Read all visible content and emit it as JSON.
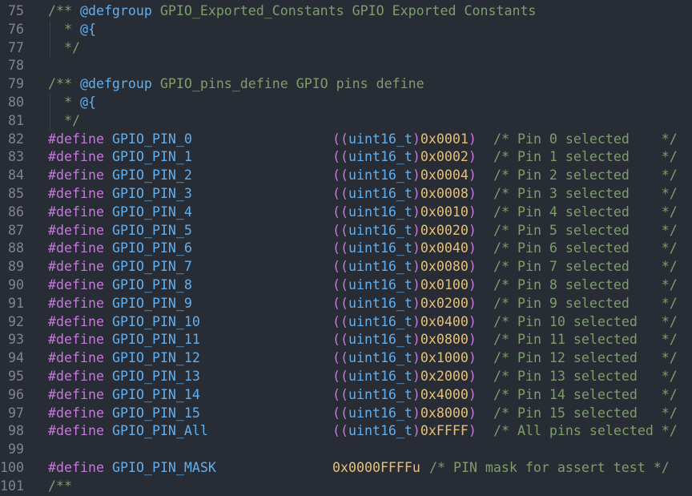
{
  "editor": {
    "colors": {
      "background": "#282c34",
      "comment": "#7f9d6b",
      "keyword": "#c678dd",
      "identifier": "#61afef",
      "literal": "#e5c07b",
      "line_number": "#7f848e"
    },
    "blocks": [
      {
        "line": "75",
        "prefix": "/** ",
        "tag": "@defgroup",
        "text": " GPIO_Exported_Constants GPIO Exported Constants"
      },
      {
        "line": "76",
        "prefix": "  * ",
        "tag": "@{",
        "text": ""
      },
      {
        "line": "77",
        "prefix": "  */",
        "tag": "",
        "text": ""
      },
      {
        "line": "78",
        "prefix": "",
        "tag": "",
        "text": ""
      },
      {
        "line": "79",
        "prefix": "/** ",
        "tag": "@defgroup",
        "text": " GPIO_pins_define GPIO pins define"
      },
      {
        "line": "80",
        "prefix": "  * ",
        "tag": "@{",
        "text": ""
      },
      {
        "line": "81",
        "prefix": "  */",
        "tag": "",
        "text": ""
      }
    ],
    "defines": [
      {
        "line": "82",
        "kw": "#define",
        "name": "GPIO_PIN_0",
        "cast_open": "((",
        "type": "uint16_t",
        "cast_close": ")",
        "value": "0x0001",
        "paren": ")",
        "comment": "/* Pin 0 selected    */"
      },
      {
        "line": "83",
        "kw": "#define",
        "name": "GPIO_PIN_1",
        "cast_open": "((",
        "type": "uint16_t",
        "cast_close": ")",
        "value": "0x0002",
        "paren": ")",
        "comment": "/* Pin 1 selected    */"
      },
      {
        "line": "84",
        "kw": "#define",
        "name": "GPIO_PIN_2",
        "cast_open": "((",
        "type": "uint16_t",
        "cast_close": ")",
        "value": "0x0004",
        "paren": ")",
        "comment": "/* Pin 2 selected    */"
      },
      {
        "line": "85",
        "kw": "#define",
        "name": "GPIO_PIN_3",
        "cast_open": "((",
        "type": "uint16_t",
        "cast_close": ")",
        "value": "0x0008",
        "paren": ")",
        "comment": "/* Pin 3 selected    */"
      },
      {
        "line": "86",
        "kw": "#define",
        "name": "GPIO_PIN_4",
        "cast_open": "((",
        "type": "uint16_t",
        "cast_close": ")",
        "value": "0x0010",
        "paren": ")",
        "comment": "/* Pin 4 selected    */"
      },
      {
        "line": "87",
        "kw": "#define",
        "name": "GPIO_PIN_5",
        "cast_open": "((",
        "type": "uint16_t",
        "cast_close": ")",
        "value": "0x0020",
        "paren": ")",
        "comment": "/* Pin 5 selected    */"
      },
      {
        "line": "88",
        "kw": "#define",
        "name": "GPIO_PIN_6",
        "cast_open": "((",
        "type": "uint16_t",
        "cast_close": ")",
        "value": "0x0040",
        "paren": ")",
        "comment": "/* Pin 6 selected    */"
      },
      {
        "line": "89",
        "kw": "#define",
        "name": "GPIO_PIN_7",
        "cast_open": "((",
        "type": "uint16_t",
        "cast_close": ")",
        "value": "0x0080",
        "paren": ")",
        "comment": "/* Pin 7 selected    */"
      },
      {
        "line": "90",
        "kw": "#define",
        "name": "GPIO_PIN_8",
        "cast_open": "((",
        "type": "uint16_t",
        "cast_close": ")",
        "value": "0x0100",
        "paren": ")",
        "comment": "/* Pin 8 selected    */"
      },
      {
        "line": "91",
        "kw": "#define",
        "name": "GPIO_PIN_9",
        "cast_open": "((",
        "type": "uint16_t",
        "cast_close": ")",
        "value": "0x0200",
        "paren": ")",
        "comment": "/* Pin 9 selected    */"
      },
      {
        "line": "92",
        "kw": "#define",
        "name": "GPIO_PIN_10",
        "cast_open": "((",
        "type": "uint16_t",
        "cast_close": ")",
        "value": "0x0400",
        "paren": ")",
        "comment": "/* Pin 10 selected   */"
      },
      {
        "line": "93",
        "kw": "#define",
        "name": "GPIO_PIN_11",
        "cast_open": "((",
        "type": "uint16_t",
        "cast_close": ")",
        "value": "0x0800",
        "paren": ")",
        "comment": "/* Pin 11 selected   */"
      },
      {
        "line": "94",
        "kw": "#define",
        "name": "GPIO_PIN_12",
        "cast_open": "((",
        "type": "uint16_t",
        "cast_close": ")",
        "value": "0x1000",
        "paren": ")",
        "comment": "/* Pin 12 selected   */"
      },
      {
        "line": "95",
        "kw": "#define",
        "name": "GPIO_PIN_13",
        "cast_open": "((",
        "type": "uint16_t",
        "cast_close": ")",
        "value": "0x2000",
        "paren": ")",
        "comment": "/* Pin 13 selected   */"
      },
      {
        "line": "96",
        "kw": "#define",
        "name": "GPIO_PIN_14",
        "cast_open": "((",
        "type": "uint16_t",
        "cast_close": ")",
        "value": "0x4000",
        "paren": ")",
        "comment": "/* Pin 14 selected   */"
      },
      {
        "line": "97",
        "kw": "#define",
        "name": "GPIO_PIN_15",
        "cast_open": "((",
        "type": "uint16_t",
        "cast_close": ")",
        "value": "0x8000",
        "paren": ")",
        "comment": "/* Pin 15 selected   */"
      },
      {
        "line": "98",
        "kw": "#define",
        "name": "GPIO_PIN_All",
        "cast_open": "((",
        "type": "uint16_t",
        "cast_close": ")",
        "value": "0xFFFF",
        "paren": ")",
        "comment": "/* All pins selected */"
      }
    ],
    "blank_line": "99",
    "mask": {
      "line": "100",
      "kw": "#define",
      "name": "GPIO_PIN_MASK",
      "value": "0x0000FFFFu",
      "comment": "/* PIN mask for assert test */"
    },
    "trailing": {
      "line": "101",
      "text": "/**"
    }
  }
}
